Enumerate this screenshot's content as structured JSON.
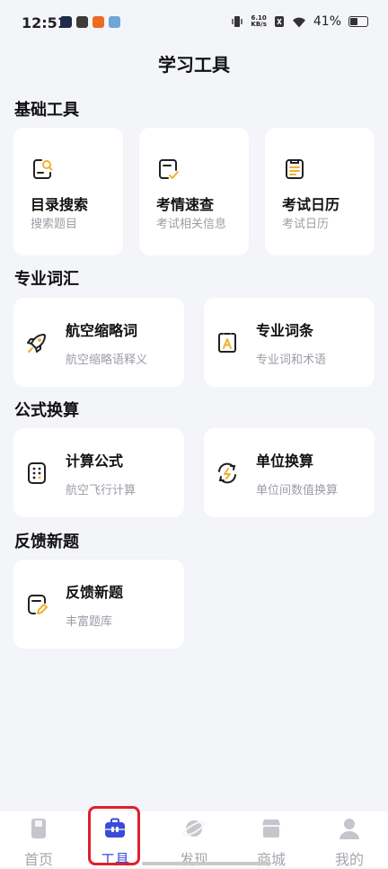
{
  "status": {
    "time": "12:51",
    "speed_top": "6.10",
    "speed_bottom": "KB/s",
    "battery": "41%"
  },
  "title": "学习工具",
  "sections": [
    {
      "title": "基础工具"
    },
    {
      "title": "专业词汇"
    },
    {
      "title": "公式换算"
    },
    {
      "title": "反馈新题"
    }
  ],
  "basic": [
    {
      "title": "目录搜索",
      "subtitle": "搜索题目",
      "icon": "catalog-search-icon"
    },
    {
      "title": "考情速查",
      "subtitle": "考试相关信息",
      "icon": "exam-check-icon"
    },
    {
      "title": "考试日历",
      "subtitle": "考试日历",
      "icon": "exam-calendar-icon"
    }
  ],
  "vocab": [
    {
      "title": "航空缩略词",
      "subtitle": "航空缩略语释义",
      "icon": "rocket-icon"
    },
    {
      "title": "专业词条",
      "subtitle": "专业词和术语",
      "icon": "glossary-icon"
    }
  ],
  "formula": [
    {
      "title": "计算公式",
      "subtitle": "航空飞行计算",
      "icon": "calculator-icon"
    },
    {
      "title": "单位换算",
      "subtitle": "单位间数值换算",
      "icon": "unit-convert-icon"
    }
  ],
  "feedback": [
    {
      "title": "反馈新题",
      "subtitle": "丰富题库",
      "icon": "feedback-edit-icon"
    }
  ],
  "tabs": [
    {
      "label": "首页",
      "icon": "home-book-icon"
    },
    {
      "label": "工具",
      "icon": "toolbox-icon"
    },
    {
      "label": "发现",
      "icon": "planet-icon"
    },
    {
      "label": "商城",
      "icon": "shop-icon"
    },
    {
      "label": "我的",
      "icon": "user-icon"
    }
  ],
  "colors": {
    "accent": "#3a4bd8",
    "icon_yellow": "#f2b12f",
    "tab_inactive": "#a4a7ad",
    "highlight": "#e0202c"
  }
}
